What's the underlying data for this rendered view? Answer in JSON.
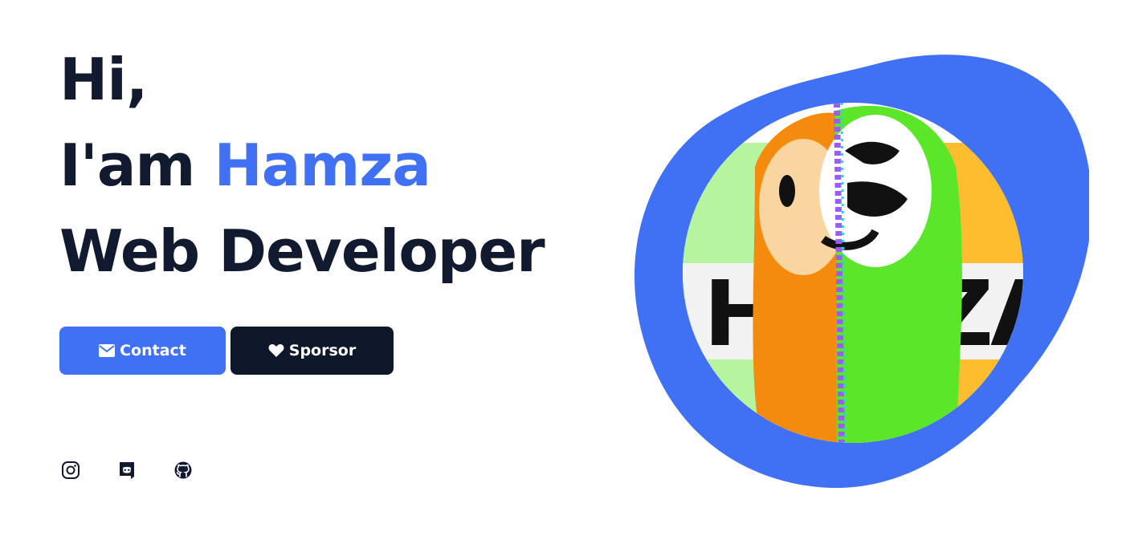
{
  "hero": {
    "greeting": "Hi,",
    "intro_prefix": "I'am",
    "name": "Hamza",
    "role": "Web Developer"
  },
  "buttons": {
    "contact_label": "Contact",
    "sponsor_label": "Sporsor"
  },
  "socials": [
    {
      "name": "instagram-icon"
    },
    {
      "name": "discord-icon"
    },
    {
      "name": "github-icon"
    }
  ],
  "avatar": {
    "banner_text": "HAMZA",
    "blob_color": "#4070f4"
  },
  "colors": {
    "accent": "#4070f4",
    "dark": "#0f172a"
  }
}
